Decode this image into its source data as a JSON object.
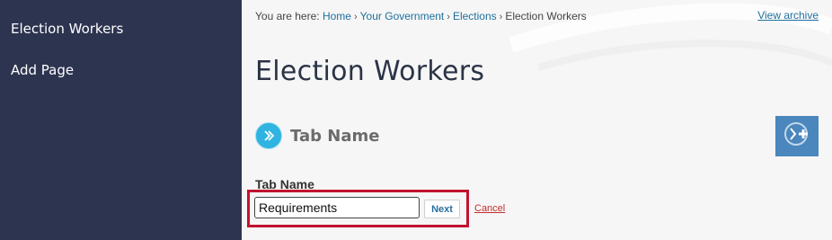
{
  "sidebar": {
    "items": [
      {
        "label": "Election Workers"
      },
      {
        "label": "Add Page"
      }
    ]
  },
  "breadcrumb": {
    "prefix": "You are here:",
    "links": [
      "Home",
      "Your Government",
      "Elections"
    ],
    "current": "Election Workers",
    "separator": "›"
  },
  "header": {
    "view_archive": "View archive"
  },
  "page": {
    "title": "Election Workers"
  },
  "tab_section": {
    "title": "Tab Name",
    "icon": "chevron-circle-icon",
    "add_icon": "add-tab-icon"
  },
  "form": {
    "label": "Tab Name",
    "value": "Requirements",
    "next_label": "Next",
    "cancel_label": "Cancel"
  },
  "colors": {
    "sidebar_bg": "#2d3450",
    "accent_blue": "#2fb3e0",
    "button_blue": "#4b86bd",
    "highlight_red": "#c1132f",
    "link_blue": "#1f6f9e"
  }
}
